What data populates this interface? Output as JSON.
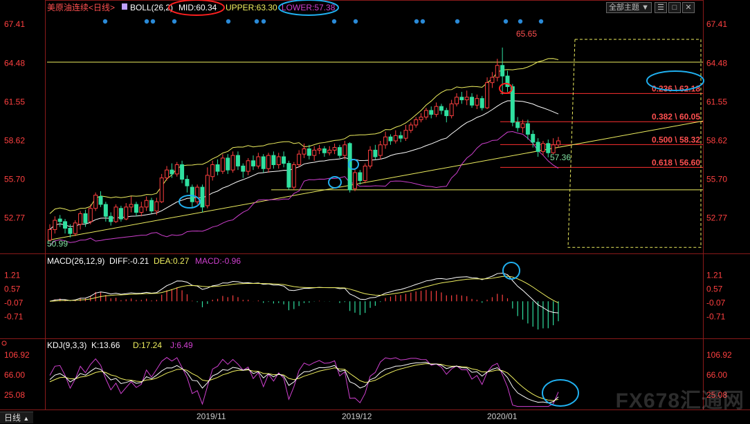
{
  "toolbar": {
    "theme_button": "全部主题",
    "theme_arrow": "▼",
    "buttons": [
      "☰",
      "□",
      "✕"
    ]
  },
  "bottom_tab": {
    "label": "日线",
    "arrow": "▲"
  },
  "watermark": "FX678汇通网",
  "colors": {
    "up": "#ff4040",
    "down": "#30e0a0",
    "boll_mid": "#ffffff",
    "boll_upper": "#f0f060",
    "boll_lower": "#d040d0",
    "dif": "#ffffff",
    "dea": "#f0f060",
    "k": "#ffffff",
    "d": "#f0f060",
    "j": "#d040d0",
    "fib_line": "#ff3030",
    "fib_text": "#ff5050",
    "highlight_blue": "#20b0f0",
    "highlight_red": "#ff2020",
    "axis_text": "#ff4040",
    "date_text": "#cccccc"
  },
  "chart_data": {
    "type": "candlestick",
    "title": "美原油连续<日线>",
    "dates": [
      "2019/11",
      "2019/12",
      "2020/01"
    ],
    "price_axis": [
      67.41,
      64.48,
      61.55,
      58.62,
      55.7,
      52.77
    ],
    "ylim": [
      50.2,
      68.2
    ],
    "boll": {
      "label": "BOLL(26,2)",
      "mid": "MID:60.34",
      "upper": "UPPER:63.30",
      "lower": "LOWER:57.38"
    },
    "annotations": {
      "high": "65.65",
      "low": "50.99",
      "recent_low": "57.36"
    },
    "fib_levels": [
      {
        "label": "0.236 \\ 62.18",
        "value": 62.18
      },
      {
        "label": "0.382 \\ 60.05",
        "value": 60.05
      },
      {
        "label": "0.500 \\ 58.32",
        "value": 58.32
      },
      {
        "label": "0.618 \\ 56.60",
        "value": 56.6
      }
    ],
    "hlines": [
      64.55,
      54.9
    ],
    "candles": [
      [
        51.1,
        51.9,
        50.99,
        52.3
      ],
      [
        51.9,
        52.6,
        51.6,
        52.9
      ],
      [
        52.7,
        52.5,
        52.1,
        53.0
      ],
      [
        52.5,
        52.0,
        51.6,
        52.7
      ],
      [
        52.0,
        51.6,
        51.3,
        52.3
      ],
      [
        51.6,
        52.4,
        51.4,
        52.6
      ],
      [
        52.3,
        53.1,
        51.9,
        53.3
      ],
      [
        53.1,
        52.4,
        52.1,
        53.4
      ],
      [
        52.5,
        53.5,
        52.3,
        53.8
      ],
      [
        53.5,
        54.5,
        53.3,
        54.7
      ],
      [
        54.4,
        53.8,
        53.6,
        54.8
      ],
      [
        53.8,
        52.9,
        52.5,
        54.0
      ],
      [
        52.9,
        52.5,
        52.2,
        53.2
      ],
      [
        52.5,
        53.6,
        52.4,
        53.8
      ],
      [
        53.5,
        52.7,
        52.5,
        53.7
      ],
      [
        52.7,
        53.6,
        52.6,
        53.9
      ],
      [
        53.6,
        53.8,
        53.2,
        54.4
      ],
      [
        53.8,
        53.2,
        52.9,
        54.0
      ],
      [
        53.2,
        53.6,
        52.9,
        54.0
      ],
      [
        53.6,
        54.1,
        53.3,
        54.4
      ],
      [
        54.1,
        53.3,
        53.1,
        54.3
      ],
      [
        53.3,
        54.0,
        53.0,
        54.3
      ],
      [
        54.0,
        55.8,
        53.9,
        56.1
      ],
      [
        55.8,
        56.4,
        55.6,
        56.7
      ],
      [
        56.4,
        56.1,
        55.8,
        56.9
      ],
      [
        56.1,
        56.8,
        55.9,
        57.0
      ],
      [
        56.8,
        55.7,
        55.4,
        57.1
      ],
      [
        55.7,
        55.2,
        54.7,
        56.0
      ],
      [
        55.1,
        54.0,
        53.5,
        55.3
      ],
      [
        54.0,
        55.1,
        53.8,
        55.3
      ],
      [
        55.1,
        53.6,
        53.2,
        55.3
      ],
      [
        53.7,
        56.0,
        53.5,
        56.6
      ],
      [
        55.9,
        56.8,
        55.6,
        57.1
      ],
      [
        56.8,
        56.3,
        56.0,
        57.2
      ],
      [
        56.3,
        57.3,
        56.1,
        57.6
      ],
      [
        57.3,
        56.4,
        56.1,
        57.6
      ],
      [
        56.4,
        57.5,
        56.2,
        57.8
      ],
      [
        57.5,
        56.7,
        56.4,
        57.8
      ],
      [
        56.7,
        56.3,
        55.8,
        56.9
      ],
      [
        56.3,
        57.1,
        56.0,
        57.3
      ],
      [
        57.1,
        56.7,
        56.4,
        57.5
      ],
      [
        56.7,
        57.4,
        56.5,
        57.7
      ],
      [
        57.4,
        56.5,
        56.2,
        57.6
      ],
      [
        56.5,
        57.5,
        56.2,
        57.7
      ],
      [
        57.5,
        56.8,
        56.5,
        57.8
      ],
      [
        56.8,
        57.4,
        56.5,
        57.7
      ],
      [
        57.4,
        56.9,
        56.6,
        57.8
      ],
      [
        56.9,
        55.1,
        54.9,
        57.1
      ],
      [
        55.1,
        56.8,
        54.9,
        57.0
      ],
      [
        56.8,
        57.6,
        56.6,
        57.9
      ],
      [
        57.6,
        58.0,
        57.3,
        58.4
      ],
      [
        58.0,
        57.5,
        57.2,
        58.3
      ],
      [
        57.5,
        57.9,
        57.1,
        58.2
      ],
      [
        57.9,
        58.0,
        57.6,
        58.3
      ],
      [
        58.0,
        57.7,
        57.4,
        58.2
      ],
      [
        57.7,
        57.9,
        57.5,
        58.2
      ],
      [
        57.9,
        58.1,
        57.6,
        58.4
      ],
      [
        58.1,
        57.5,
        57.3,
        58.3
      ],
      [
        57.5,
        58.3,
        57.2,
        58.6
      ],
      [
        58.4,
        54.9,
        54.7,
        58.5
      ],
      [
        55.0,
        56.2,
        54.8,
        56.5
      ],
      [
        56.2,
        55.6,
        55.3,
        56.4
      ],
      [
        55.6,
        56.7,
        55.4,
        56.9
      ],
      [
        56.7,
        57.9,
        56.5,
        58.2
      ],
      [
        57.9,
        57.4,
        57.2,
        58.3
      ],
      [
        57.5,
        58.3,
        57.2,
        58.6
      ],
      [
        58.3,
        58.9,
        58.0,
        59.3
      ],
      [
        58.9,
        58.6,
        58.3,
        59.1
      ],
      [
        58.6,
        59.0,
        58.4,
        59.4
      ],
      [
        59.0,
        58.8,
        58.5,
        59.3
      ],
      [
        58.8,
        59.4,
        58.6,
        59.8
      ],
      [
        59.4,
        59.8,
        59.2,
        60.0
      ],
      [
        59.8,
        60.2,
        59.6,
        60.4
      ],
      [
        60.2,
        60.4,
        60.0,
        60.7
      ],
      [
        60.4,
        60.9,
        60.2,
        61.1
      ],
      [
        60.9,
        60.6,
        60.3,
        61.2
      ],
      [
        60.6,
        61.2,
        60.4,
        61.5
      ],
      [
        61.2,
        60.9,
        60.6,
        61.4
      ],
      [
        60.9,
        60.5,
        60.0,
        61.1
      ],
      [
        60.5,
        61.4,
        60.3,
        61.7
      ],
      [
        61.4,
        61.9,
        61.2,
        62.2
      ],
      [
        61.9,
        61.7,
        61.4,
        62.3
      ],
      [
        61.7,
        61.9,
        61.3,
        62.4
      ],
      [
        61.9,
        61.3,
        61.1,
        62.2
      ],
      [
        61.3,
        61.8,
        61.0,
        62.1
      ],
      [
        61.8,
        61.1,
        60.9,
        62.0
      ],
      [
        61.1,
        63.0,
        61.0,
        63.4
      ],
      [
        63.0,
        63.4,
        62.6,
        63.8
      ],
      [
        63.4,
        64.3,
        63.1,
        64.8
      ],
      [
        64.3,
        63.5,
        62.1,
        65.65
      ],
      [
        63.5,
        62.7,
        62.3,
        63.9
      ],
      [
        62.7,
        60.0,
        59.7,
        62.9
      ],
      [
        60.0,
        59.6,
        59.3,
        60.4
      ],
      [
        59.6,
        59.9,
        59.2,
        60.2
      ],
      [
        59.9,
        59.1,
        58.7,
        60.2
      ],
      [
        59.1,
        58.5,
        58.1,
        59.4
      ],
      [
        58.5,
        57.8,
        57.4,
        58.8
      ],
      [
        57.8,
        58.4,
        57.5,
        58.6
      ],
      [
        58.4,
        57.7,
        57.36,
        58.7
      ],
      [
        57.7,
        58.3,
        57.6,
        58.8
      ],
      [
        58.3,
        58.6,
        58.1,
        58.9
      ]
    ],
    "macd": {
      "label": "MACD(26,12,9)",
      "dif_label": "DIFF:-0.21",
      "dea_label": "DEA:0.27",
      "macd_label": "MACD:-0.96",
      "axis": [
        1.21,
        0.57,
        -0.07,
        -0.71
      ],
      "ylim": [
        -1.6,
        1.65
      ]
    },
    "kdj": {
      "label": "KDJ(9,3,3)",
      "k_label": "K:13.66",
      "d_label": "D:17.24",
      "j_label": "J:6.49",
      "axis": [
        106.92,
        66.0,
        25.08
      ],
      "ylim": [
        0,
        118
      ]
    }
  }
}
